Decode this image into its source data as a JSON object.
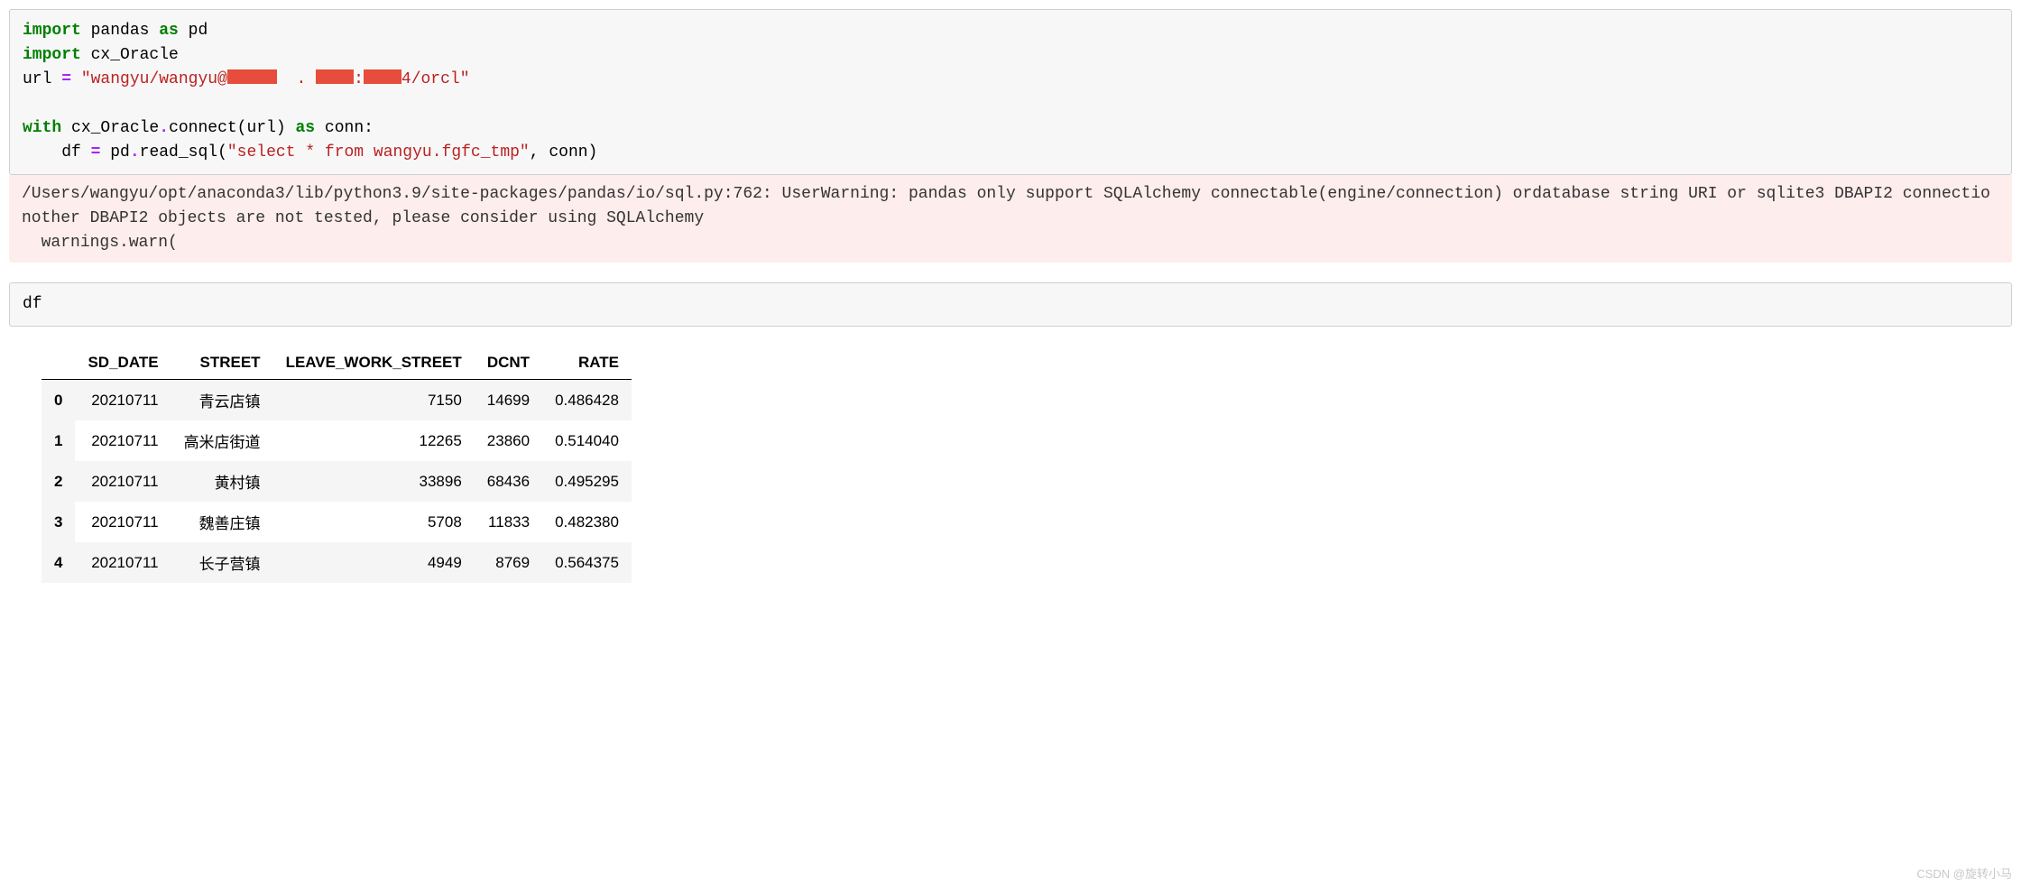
{
  "code_cell_1": {
    "line1": {
      "kw_import": "import",
      "pandas": " pandas ",
      "kw_as": "as",
      "pd": " pd"
    },
    "line2": {
      "kw_import": "import",
      "cx_oracle": " cx_Oracle"
    },
    "line3": {
      "url_var": "url ",
      "eq": "=",
      "str_part1": " \"wangyu/wangyu@",
      "str_part2": "4/orcl\""
    },
    "line5": {
      "kw_with": "with",
      "cx_connect": " cx_Oracle",
      "dot": ".",
      "connect": "connect(url) ",
      "kw_as": "as",
      "conn": " conn:"
    },
    "line6": {
      "indent": "    df ",
      "eq": "=",
      "pd_read": " pd",
      "dot": ".",
      "read_sql": "read_sql(",
      "sql_str": "\"select * from wangyu.fgfc_tmp\"",
      "conn_arg": ", conn)"
    }
  },
  "warning": "/Users/wangyu/opt/anaconda3/lib/python3.9/site-packages/pandas/io/sql.py:762: UserWarning: pandas only support SQLAlchemy connectable(engine/connection) ordatabase string URI or sqlite3 DBAPI2 connectionother DBAPI2 objects are not tested, please consider using SQLAlchemy\n  warnings.warn(",
  "code_cell_2": "df",
  "chart_data": {
    "type": "table",
    "columns": [
      "SD_DATE",
      "STREET",
      "LEAVE_WORK_STREET",
      "DCNT",
      "RATE"
    ],
    "index": [
      "0",
      "1",
      "2",
      "3",
      "4"
    ],
    "rows": [
      [
        "20210711",
        "青云店镇",
        "7150",
        "14699",
        "0.486428"
      ],
      [
        "20210711",
        "高米店街道",
        "12265",
        "23860",
        "0.514040"
      ],
      [
        "20210711",
        "黄村镇",
        "33896",
        "68436",
        "0.495295"
      ],
      [
        "20210711",
        "魏善庄镇",
        "5708",
        "11833",
        "0.482380"
      ],
      [
        "20210711",
        "长子营镇",
        "4949",
        "8769",
        "0.564375"
      ]
    ]
  },
  "watermark": "CSDN @旋转小马"
}
